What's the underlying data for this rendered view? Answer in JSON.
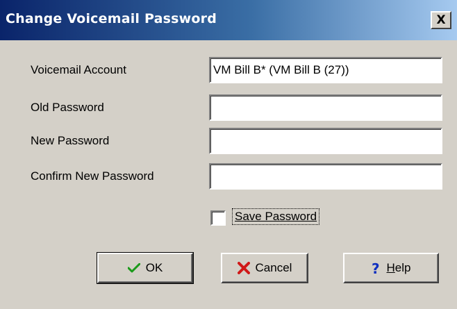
{
  "window": {
    "title": "Change Voicemail Password",
    "close_label": "X"
  },
  "form": {
    "voicemail_account": {
      "label": "Voicemail Account",
      "value": "VM Bill B* (VM Bill B (27))"
    },
    "old_password": {
      "label": "Old Password",
      "value": ""
    },
    "new_password": {
      "label": "New Password",
      "value": ""
    },
    "confirm_password": {
      "label": "Confirm New Password",
      "value": ""
    },
    "save_password": {
      "label": "Save Password",
      "checked": false
    }
  },
  "buttons": {
    "ok": {
      "label": "OK",
      "icon": "checkmark-icon"
    },
    "cancel": {
      "label": "Cancel",
      "icon": "red-x-icon"
    },
    "help": {
      "label_first": "H",
      "label_rest": "elp",
      "icon": "question-icon"
    }
  },
  "colors": {
    "title_bar_start": "#0a246a",
    "title_bar_end": "#a6caf0",
    "face": "#d4d0c8"
  }
}
